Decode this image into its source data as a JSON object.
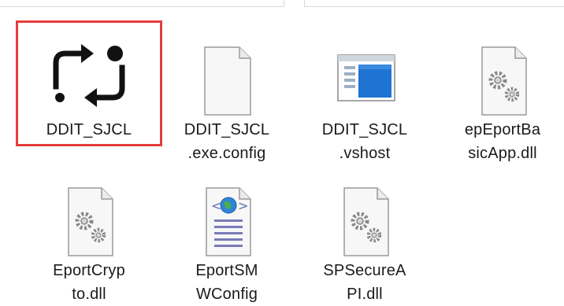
{
  "window": {
    "selected_outline_color": "#e53c3c"
  },
  "files": [
    {
      "id": "ddit-sjcl",
      "icon": "sync-arrows-app-icon",
      "name_lines": [
        "DDIT_SJCL"
      ]
    },
    {
      "id": "ddit-sjcl-exe-config",
      "icon": "blank-document-icon",
      "name_lines": [
        "DDIT_SJCL",
        ".exe.config"
      ]
    },
    {
      "id": "ddit-sjcl-vshost",
      "icon": "application-window-icon",
      "name_lines": [
        "DDIT_SJCL",
        ".vshost"
      ]
    },
    {
      "id": "epeportbasicapp-dll",
      "icon": "dll-gear-file-icon",
      "name_lines": [
        "epEportBa",
        "sicApp.dll"
      ]
    },
    {
      "id": "eportcrypto-dll",
      "icon": "dll-gear-file-icon",
      "name_lines": [
        "EportCryp",
        "to.dll"
      ]
    },
    {
      "id": "eportsmwconfig",
      "icon": "web-config-file-icon",
      "name_lines": [
        "EportSM",
        "WConfig"
      ]
    },
    {
      "id": "spsecureapi-dll",
      "icon": "dll-gear-file-icon",
      "name_lines": [
        "SPSecureA",
        "PI.dll"
      ]
    }
  ]
}
